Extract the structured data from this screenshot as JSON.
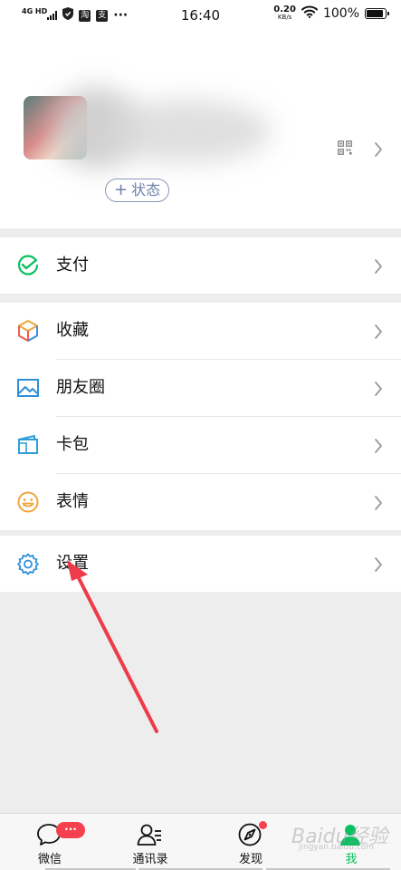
{
  "status_bar": {
    "network": "4G HD",
    "app_badges": [
      "淘",
      "支"
    ],
    "more": "···",
    "time": "16:40",
    "speed_value": "0.20",
    "speed_unit": "KB/s",
    "battery_pct": "100%",
    "battery_level": 1.0
  },
  "profile": {
    "status_button": "状态",
    "status_plus": "+"
  },
  "menu": {
    "pay": {
      "label": "支付",
      "icon": "wechat-pay-icon"
    },
    "favorites": {
      "label": "收藏",
      "icon": "cube-icon"
    },
    "moments": {
      "label": "朋友圈",
      "icon": "image-icon"
    },
    "cards": {
      "label": "卡包",
      "icon": "card-wallet-icon"
    },
    "stickers": {
      "label": "表情",
      "icon": "smile-icon"
    },
    "settings": {
      "label": "设置",
      "icon": "gear-icon"
    }
  },
  "tabs": [
    {
      "label": "微信",
      "icon": "chat-bubble-icon",
      "badge": "···"
    },
    {
      "label": "通讯录",
      "icon": "contacts-icon"
    },
    {
      "label": "发现",
      "icon": "compass-icon"
    },
    {
      "label": "我",
      "icon": "person-icon",
      "active": true
    }
  ],
  "watermark": {
    "main": "Baidu经验",
    "sub": "jingyan.baidu.com"
  },
  "colors": {
    "accent_green": "#07c160",
    "badge_red": "#f5414d",
    "arrow_red": "#ef3a4a",
    "status_pill": "#6d7fa8",
    "background": "#ededed"
  }
}
